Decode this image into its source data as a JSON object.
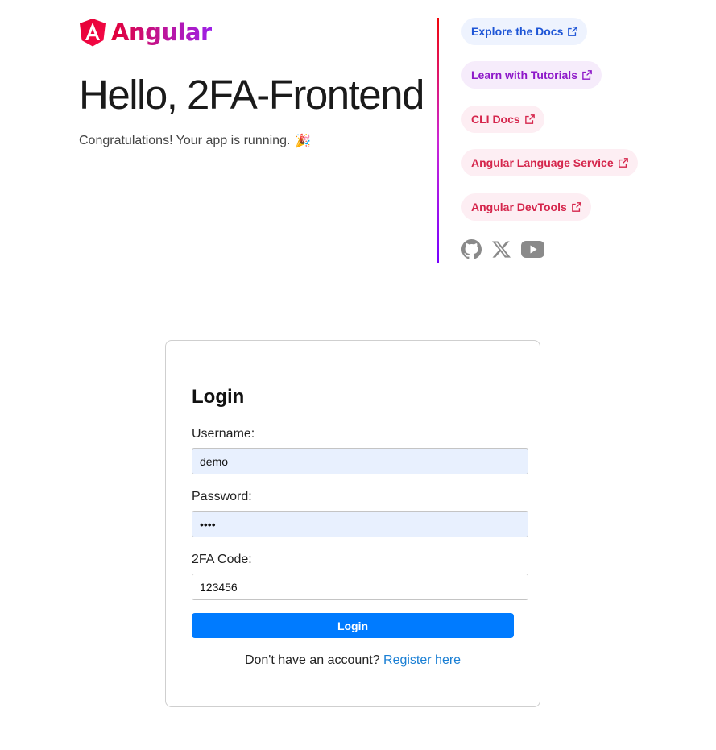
{
  "header": {
    "logo_text": "Angular",
    "title": "Hello, 2FA-Frontend",
    "subtitle": "Congratulations! Your app is running.",
    "subtitle_emoji": "🎉"
  },
  "links": [
    {
      "label": "Explore the Docs"
    },
    {
      "label": "Learn with Tutorials"
    },
    {
      "label": "CLI Docs"
    },
    {
      "label": "Angular Language Service"
    },
    {
      "label": "Angular DevTools"
    }
  ],
  "social": [
    "github-icon",
    "x-icon",
    "youtube-icon"
  ],
  "login": {
    "title": "Login",
    "username_label": "Username:",
    "username_value": "demo",
    "password_label": "Password:",
    "password_value": "••••",
    "code_label": "2FA Code:",
    "code_value": "123456",
    "submit_label": "Login",
    "register_prompt": "Don't have an account?",
    "register_link": "Register here"
  },
  "colors": {
    "accent_blue": "#007bff",
    "link_blue": "#1a7fd4",
    "input_fill": "#e8f0fe"
  }
}
